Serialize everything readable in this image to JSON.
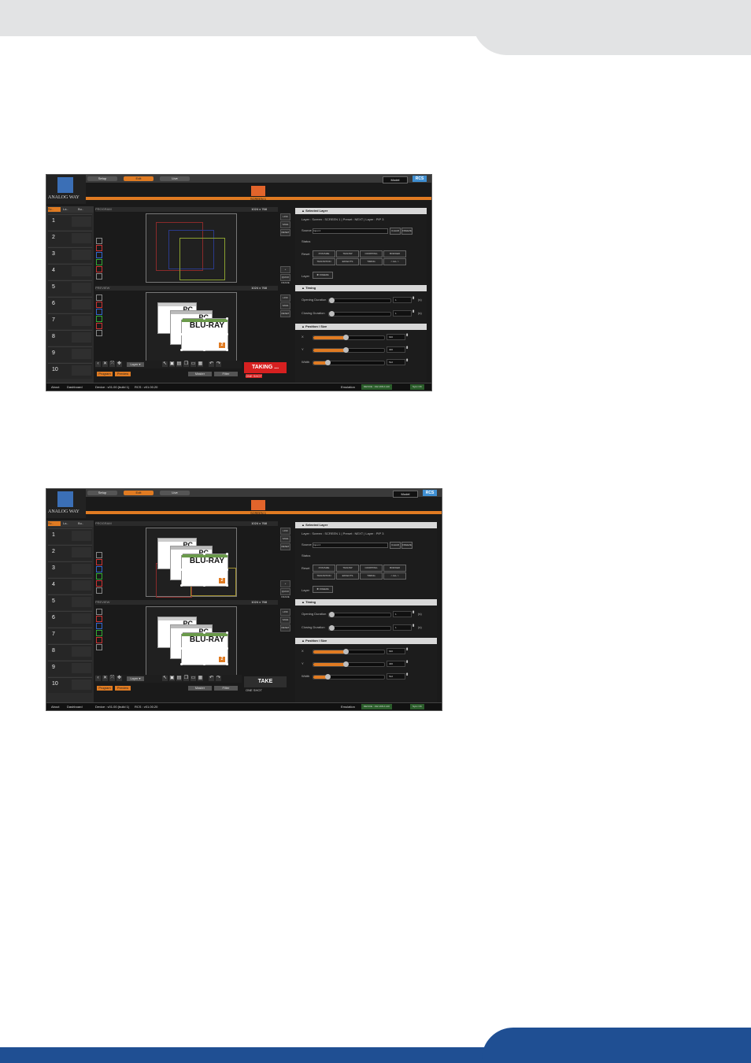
{
  "app": {
    "logo": "ANALOG WAY",
    "tabs": [
      "Setup",
      "Edit",
      "Live"
    ],
    "model": "Model",
    "brand": "RCS",
    "screen_label": "SCREEN 1",
    "left_tabs": [
      "Sc..",
      "La..",
      "Bu.."
    ],
    "presets": [
      "1",
      "2",
      "3",
      "4",
      "5",
      "6",
      "7",
      "8",
      "9",
      "10"
    ],
    "program_label": "PROGRAM",
    "preview_label": "PREVIEW",
    "resolution": "1024 x 768",
    "side_buttons": [
      "LINK",
      "SAVE ALL",
      "RESET"
    ],
    "quick_frame": "QUICK FRAME",
    "layer_select": "Layer ▾",
    "program_btn": "Program",
    "preview_btn": "Preview",
    "master_btn": "Master",
    "filter_btn": "Filter",
    "source_titles": [
      "PC",
      "PC",
      "BLU-RAY"
    ],
    "selected_layer": {
      "title": "Selected Layer",
      "info": "Layer : Screen : SCREEN 1  |  Preset : NEXT  |  Layer : PIP 3",
      "source_label": "Source",
      "source_value": "Input 4",
      "clear_btn": "CLEAR",
      "freeze_btn": "FREEZE",
      "status_label": "Status",
      "reset_label": "Reset",
      "reset_btns": [
        "POS/SIZE",
        "TRANSP",
        "CROPPING",
        "BORDER",
        "TRANSITION",
        "EFFECTS",
        "TIMING",
        "< ALL >"
      ],
      "layer_label": "Layer",
      "freeze_layer": "FREEZE"
    },
    "timing": {
      "title": "Timing",
      "opening_label": "Opening Duration",
      "closing_label": "Closing Duration",
      "opening_value": "1",
      "closing_value": "1",
      "unit": "(s)"
    },
    "position": {
      "title": "Position / Size",
      "x_label": "X",
      "y_label": "Y",
      "width_label": "Width",
      "x_value": "640",
      "y_value": "400",
      "width_value": "512",
      "x_fill": 0.45,
      "y_fill": 0.45,
      "width_fill": 0.2
    },
    "status_bar": {
      "about": "About",
      "dashboard": "Dashboard",
      "device": "Device : v01.00 (build 1)",
      "rcs": "RCS : v01.00.20",
      "emulation": "Emulation",
      "ip": "DEVICE : 192.168.2.140",
      "sync": "Sync OK"
    }
  },
  "screenshots": [
    {
      "take_label": "TAKING ...",
      "take_caption": "ONE SHOT",
      "take_color": "#d62020"
    },
    {
      "take_label": "TAKE",
      "take_caption": "ONE SHOT",
      "take_color": "#2e2e2e"
    }
  ]
}
